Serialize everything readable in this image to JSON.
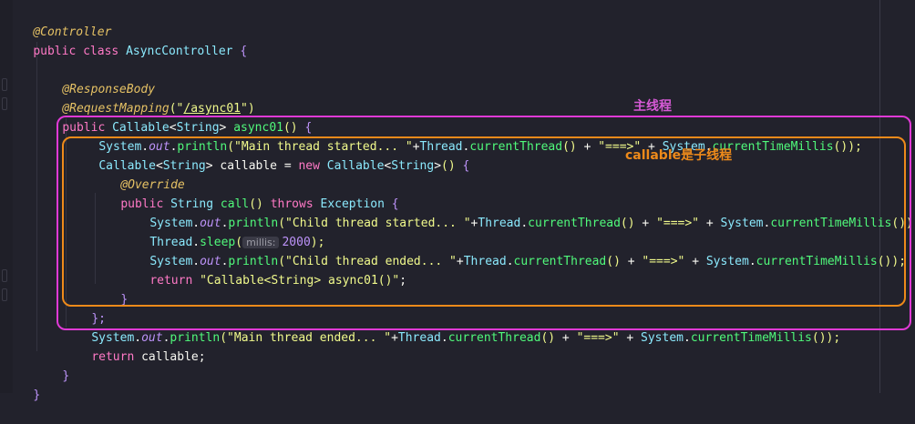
{
  "code": {
    "l1": {
      "annotation": "@Controller"
    },
    "l2": {
      "kw1": "public",
      "kw2": "class",
      "name": "AsyncController",
      "brace": "{"
    },
    "l4": {
      "annotation": "@ResponseBody"
    },
    "l5": {
      "annotation": "@RequestMapping",
      "open": "(\"",
      "path": "/async01",
      "close": "\")"
    },
    "l6": {
      "kw": "public",
      "type": "Callable",
      "lt": "<",
      "generic": "String",
      "gt": ">",
      "method": "async01",
      "parens": "()",
      "brace": "{"
    },
    "l7": {
      "cls": "System",
      "dot1": ".",
      "field": "out",
      "dot2": ".",
      "method": "println",
      "open": "(",
      "str1": "\"Main thread started... \"",
      "plus1": "+",
      "cls2": "Thread",
      "dot3": ".",
      "method2": "currentThread",
      "parens": "()",
      "plus2": " + ",
      "str2": "\"===>\"",
      "plus3": " + ",
      "cls3": "System",
      "dot4": ".",
      "method3": "currentTimeMillis",
      "parens2": "()",
      "close": ");"
    },
    "l8": {
      "type": "Callable",
      "lt": "<",
      "generic": "String",
      "gt": ">",
      "var": " callable = ",
      "kw": "new",
      "type2": "Callable",
      "lt2": "<",
      "generic2": "String",
      "gt2": ">",
      "parens": "()",
      "brace": "{"
    },
    "l9": {
      "annotation": "@Override"
    },
    "l10": {
      "kw": "public",
      "type": "String",
      "method": "call",
      "parens": "()",
      "kw2": "throws",
      "type2": "Exception",
      "brace": "{"
    },
    "l11": {
      "cls": "System",
      "dot1": ".",
      "field": "out",
      "dot2": ".",
      "method": "println",
      "open": "(",
      "str1": "\"Child thread started... \"",
      "plus1": "+",
      "cls2": "Thread",
      "dot3": ".",
      "method2": "currentThread",
      "parens": "()",
      "plus2": " + ",
      "str2": "\"===>\"",
      "plus3": " + ",
      "cls3": "System",
      "dot4": ".",
      "method3": "currentTimeMillis",
      "parens2": "()",
      "close": ");"
    },
    "l12": {
      "cls": "Thread",
      "dot": ".",
      "method": "sleep",
      "open": "(",
      "hint": "millis:",
      "num": "2000",
      "close": ");"
    },
    "l13": {
      "cls": "System",
      "dot1": ".",
      "field": "out",
      "dot2": ".",
      "method": "println",
      "open": "(",
      "str1": "\"Child thread ended... \"",
      "plus1": "+",
      "cls2": "Thread",
      "dot3": ".",
      "method2": "currentThread",
      "parens": "()",
      "plus2": " + ",
      "str2": "\"===>\"",
      "plus3": " + ",
      "cls3": "System",
      "dot4": ".",
      "method3": "currentTimeMillis",
      "parens2": "()",
      "close": ");"
    },
    "l14": {
      "kw": "return",
      "str": "\"Callable<String> async01()\"",
      "semi": ";"
    },
    "l15": {
      "brace": "}"
    },
    "l16": {
      "text": "};"
    },
    "l17": {
      "cls": "System",
      "dot1": ".",
      "field": "out",
      "dot2": ".",
      "method": "println",
      "open": "(",
      "str1": "\"Main thread ended... \"",
      "plus1": "+",
      "cls2": "Thread",
      "dot3": ".",
      "method2": "currentThread",
      "parens": "()",
      "plus2": " + ",
      "str2": "\"===>\"",
      "plus3": " + ",
      "cls3": "System",
      "dot4": ".",
      "method3": "currentTimeMillis",
      "parens2": "()",
      "close": ");"
    },
    "l18": {
      "kw": "return",
      "text": " callable;"
    },
    "l19": {
      "brace": "}"
    },
    "l20": {
      "brace": "}"
    }
  },
  "annotations": {
    "main_thread_label": "主线程",
    "child_thread_label": "callable是子线程",
    "main_color": "#e03ad6",
    "child_color": "#ee8a1a"
  }
}
